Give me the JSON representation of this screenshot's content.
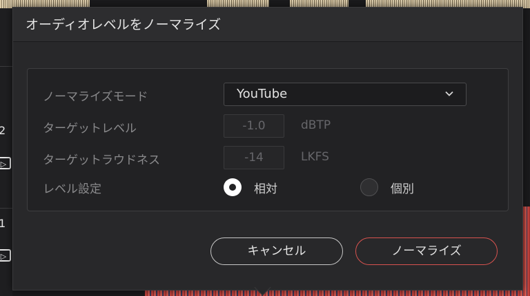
{
  "dialog": {
    "title": "オーディオレベルをノーマライズ"
  },
  "form": {
    "mode_label": "ノーマライズモード",
    "mode_value": "YouTube",
    "target_level_label": "ターゲットレベル",
    "target_level_value": "-1.0",
    "target_level_unit": "dBTP",
    "target_loudness_label": "ターゲットラウドネス",
    "target_loudness_value": "-14",
    "target_loudness_unit": "LKFS",
    "level_setting_label": "レベル設定",
    "relative_label": "相対",
    "individual_label": "個別",
    "selected_option": "相対"
  },
  "buttons": {
    "cancel_label": "キャンセル",
    "normalize_label": "ノーマライズ"
  },
  "background": {
    "left_marks": [
      "2",
      "1"
    ]
  },
  "colors": {
    "accent": "#d9534f",
    "dialog_bg": "#28282a",
    "panel_bg": "#222224"
  },
  "icons": {
    "dropdown": "chevron-down-icon",
    "option_box": "clip-box-icon"
  }
}
